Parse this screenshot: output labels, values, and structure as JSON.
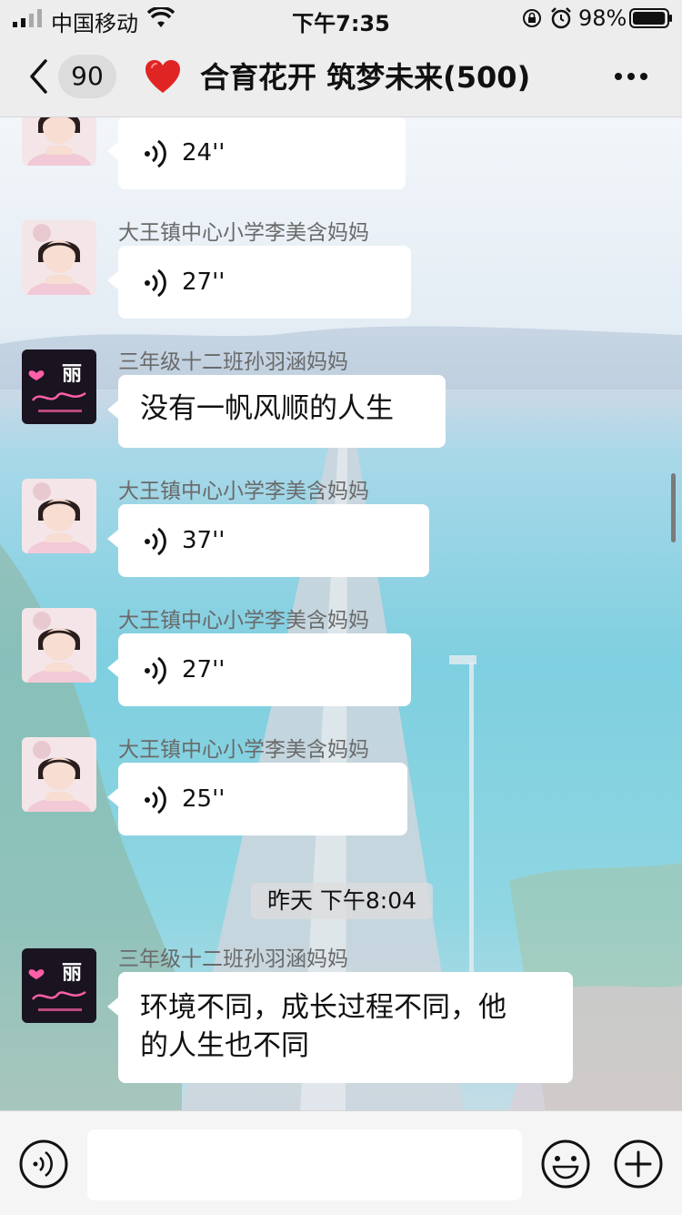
{
  "status_bar": {
    "carrier": "中国移动",
    "time": "下午7:35",
    "battery_pct": "98%",
    "battery_level": 0.98
  },
  "nav": {
    "back_count": "90",
    "title": "合育花开 筑梦未来(500)"
  },
  "messages": [
    {
      "type": "voice",
      "sender": "",
      "duration": "24''"
    },
    {
      "type": "voice",
      "sender": "大王镇中心小学李美含妈妈",
      "duration": "27''"
    },
    {
      "type": "text",
      "sender": "三年级十二班孙羽涵妈妈",
      "text": "没有一帆风顺的人生"
    },
    {
      "type": "voice",
      "sender": "大王镇中心小学李美含妈妈",
      "duration": "37''"
    },
    {
      "type": "voice",
      "sender": "大王镇中心小学李美含妈妈",
      "duration": "27''"
    },
    {
      "type": "voice",
      "sender": "大王镇中心小学李美含妈妈",
      "duration": "25''"
    },
    {
      "type": "text",
      "sender": "三年级十二班孙羽涵妈妈",
      "text_line1": "环境不同，成长过程不同，他",
      "text_line2": "的人生也不同"
    }
  ],
  "timestamp": "昨天 下午8:04",
  "avatar_logo_text": "丽",
  "input": {
    "placeholder": ""
  },
  "icons": {
    "back": "chevron-left-icon",
    "heart": "heart-icon",
    "more": "more-icon",
    "voice": "voice-wave-icon",
    "emoji": "emoji-icon",
    "plus": "plus-icon"
  },
  "colors": {
    "bar_bg": "#ededed",
    "bubble_bg": "#ffffff",
    "heart": "#e02424",
    "logo_bg": "#1a1420",
    "logo_pink": "#ff5fa8"
  }
}
